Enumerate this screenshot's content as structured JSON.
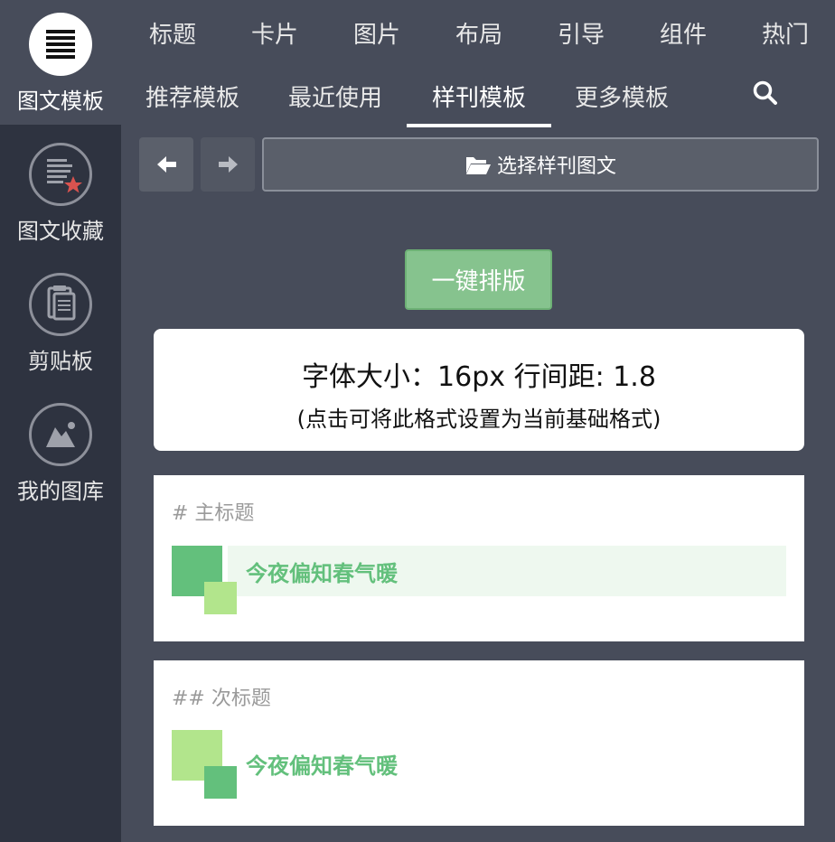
{
  "sidebar": {
    "items": [
      {
        "label": "图文模板",
        "icon": "list-icon"
      },
      {
        "label": "图文收藏",
        "icon": "favorite-doc-icon"
      },
      {
        "label": "剪贴板",
        "icon": "clipboard-icon"
      },
      {
        "label": "我的图库",
        "icon": "image-gallery-icon"
      }
    ]
  },
  "nav": {
    "primary": [
      "标题",
      "卡片",
      "图片",
      "布局",
      "引导",
      "组件",
      "热门"
    ],
    "secondary": [
      "推荐模板",
      "最近使用",
      "样刊模板",
      "更多模板"
    ],
    "active_secondary": "样刊模板"
  },
  "toolbar": {
    "pick_label": "选择样刊图文"
  },
  "onekey_label": "一键排版",
  "info": {
    "line1": "字体大小：16px 行间距: 1.8",
    "line2": "(点击可将此格式设置为当前基础格式)"
  },
  "cards": [
    {
      "header": "# 主标题",
      "title": "今夜偏知春气暖"
    },
    {
      "header": "## 次标题",
      "title": "今夜偏知春气暖"
    }
  ],
  "colors": {
    "accent_green": "#63c07c",
    "light_green": "#b2e58c",
    "button_green": "#86c38e"
  }
}
